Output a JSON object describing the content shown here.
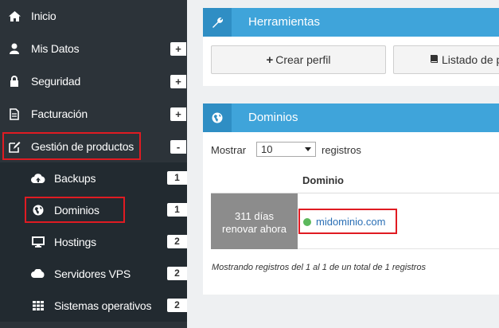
{
  "sidebar": {
    "items": [
      {
        "label": "Inicio",
        "icon": "home-icon"
      },
      {
        "label": "Mis Datos",
        "icon": "user-icon",
        "toggle": "+"
      },
      {
        "label": "Seguridad",
        "icon": "lock-icon",
        "toggle": "+"
      },
      {
        "label": "Facturación",
        "icon": "file-icon",
        "toggle": "+"
      },
      {
        "label": "Gestión de productos",
        "icon": "edit-icon",
        "toggle": "-"
      }
    ],
    "subitems": [
      {
        "label": "Backups",
        "icon": "cloud-upload-icon",
        "count": "1"
      },
      {
        "label": "Dominios",
        "icon": "globe-icon",
        "count": "1"
      },
      {
        "label": "Hostings",
        "icon": "monitor-icon",
        "count": "2"
      },
      {
        "label": "Servidores VPS",
        "icon": "cloud-icon",
        "count": "2"
      },
      {
        "label": "Sistemas operativos",
        "icon": "grid-icon",
        "count": "2"
      }
    ]
  },
  "tools_panel": {
    "title": "Herramientas",
    "icon": "wrench-icon",
    "create_button": "Crear perfil",
    "list_button": "Listado de p"
  },
  "domains_panel": {
    "title": "Dominios",
    "icon": "globe-icon",
    "show_label": "Mostrar",
    "page_size": "10",
    "records_label": "registros",
    "column_header": "Dominio",
    "rows": [
      {
        "renew_days": "311 días",
        "renew_action": "renovar ahora",
        "domain": "midominio.com",
        "status_color": "#5cb85c"
      }
    ],
    "footer": "Mostrando registros del 1 al 1 de un total de 1 registros"
  },
  "colors": {
    "sidebar_bg": "#2c3339",
    "accent": "#3fa4da",
    "highlight": "#e01b22"
  }
}
